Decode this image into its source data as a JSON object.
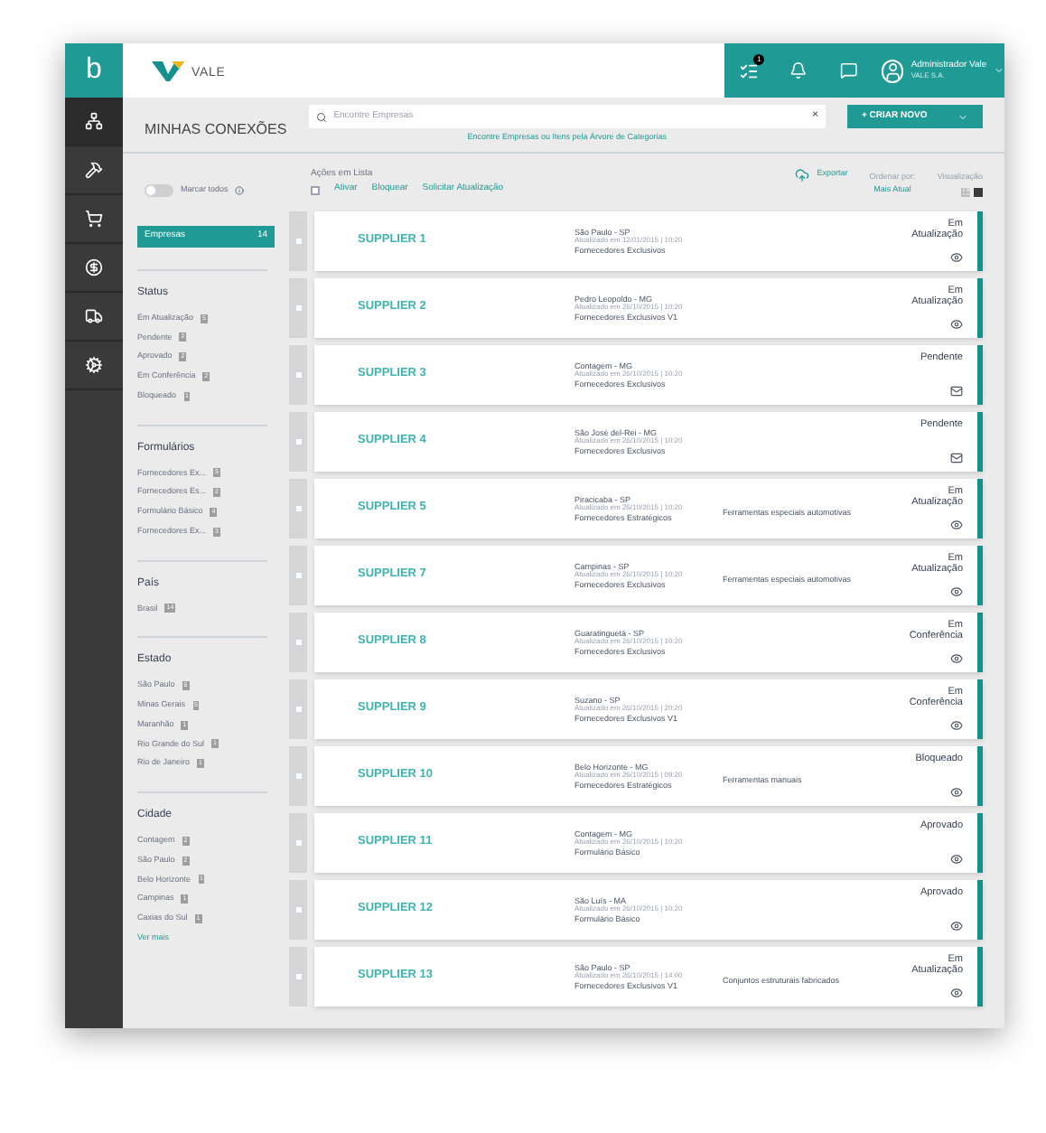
{
  "brand": {
    "logo_letter": "b",
    "name": "VALE"
  },
  "rail": [
    {
      "kind": "network",
      "selected": true
    },
    {
      "kind": "hammer",
      "selected": false
    },
    {
      "kind": "cart",
      "selected": false
    },
    {
      "kind": "coin",
      "selected": false
    },
    {
      "kind": "truck",
      "selected": false
    },
    {
      "kind": "gears",
      "selected": false
    }
  ],
  "header": {
    "notification_count": "1",
    "user_name": "Administrador Vale",
    "user_company": "VALE S.A."
  },
  "page_title": "MINHAS CONEXÕES",
  "search": {
    "placeholder": "Encontre Empresas",
    "clear": "×",
    "link": "Encontre Empresas ou Itens pela Árvore de Categorias"
  },
  "create_button": "+ CRIAR NOVO",
  "toggle": {
    "label": "Marcar todos",
    "on": false
  },
  "list_actions": {
    "title": "Ações em Lista",
    "checked": false,
    "actions": [
      "Ativar",
      "Bloquear",
      "Solicitar Atualização"
    ]
  },
  "export": "Exportar",
  "sort": {
    "label": "Ordenar por:",
    "value": "Mais Atual"
  },
  "view": {
    "label": "Visualização",
    "options": [
      {
        "kind": "grid",
        "selected": false
      },
      {
        "kind": "list",
        "selected": true
      }
    ]
  },
  "companies_tab": {
    "label": "Empresas",
    "count": "14"
  },
  "filters": [
    {
      "title": "Status",
      "items": [
        {
          "label": "Em Atualização",
          "count": "5"
        },
        {
          "label": "Pendente",
          "count": "2"
        },
        {
          "label": "Aprovado",
          "count": "2"
        },
        {
          "label": "Em Conferência",
          "count": "2"
        },
        {
          "label": "Bloqueado",
          "count": "1"
        }
      ]
    },
    {
      "title": "Formulários",
      "items": [
        {
          "label": "Fornecedores Ex...",
          "count": "5"
        },
        {
          "label": "Fornecedores Es...",
          "count": "2"
        },
        {
          "label": "Formulário Básico",
          "count": "4"
        },
        {
          "label": "Fornecedores Ex...",
          "count": "3"
        }
      ]
    },
    {
      "title": "País",
      "items": [
        {
          "label": "Brasil",
          "count": "14"
        }
      ]
    },
    {
      "title": "Estado",
      "items": [
        {
          "label": "São Paulo",
          "count": "6"
        },
        {
          "label": "Minas Gerais",
          "count": "5"
        },
        {
          "label": "Maranhão",
          "count": "1"
        },
        {
          "label": "Rio Grande do Sul",
          "count": "1"
        },
        {
          "label": "Rio de Janeiro",
          "count": "1"
        }
      ]
    },
    {
      "title": "Cidade",
      "items": [
        {
          "label": "Contagem",
          "count": "2"
        },
        {
          "label": "São Paulo",
          "count": "2"
        },
        {
          "label": "Belo Horizonte",
          "count": "1"
        },
        {
          "label": "Campinas",
          "count": "1"
        },
        {
          "label": "Caxias do Sul",
          "count": "1"
        }
      ],
      "more": "Ver mais"
    }
  ],
  "suppliers": [
    {
      "kind": "view",
      "checked": false,
      "name": "SUPPLIER 1",
      "location": "São Paulo - SP",
      "updated": "Atualizado em 12/01/2015 | 10:20",
      "category": "Fornecedores Exclusivos",
      "status": "Em Atualização"
    },
    {
      "kind": "view",
      "checked": false,
      "name": "SUPPLIER 2",
      "location": "Pedro Leopoldo - MG",
      "updated": "Atualizado em 26/10/2015 | 10:20",
      "category": "Fornecedores Exclusivos V1",
      "status": "Em Atualização"
    },
    {
      "kind": "mail",
      "checked": false,
      "name": "SUPPLIER 3",
      "location": "Contagem - MG",
      "updated": "Atualizado em 26/10/2015 | 10:20",
      "category": "Fornecedores Exclusivos",
      "status": "Pendente"
    },
    {
      "kind": "mail",
      "checked": false,
      "name": "SUPPLIER 4",
      "location": "São José del-Rei - MG",
      "updated": "Atualizado em 26/10/2015 | 10:20",
      "category": "Fornecedores Exclusivos",
      "status": "Pendente"
    },
    {
      "kind": "view",
      "checked": false,
      "name": "SUPPLIER 5",
      "location": "Piracicaba - SP",
      "updated": "Atualizado em 26/10/2015 | 10:20",
      "category": "Fornecedores Estratégicos",
      "tag": "Ferramentas especiais automotivas",
      "status": "Em Atualização"
    },
    {
      "kind": "view",
      "checked": false,
      "name": "SUPPLIER 7",
      "location": "Campinas - SP",
      "updated": "Atualizado em 26/10/2015 | 10:20",
      "category": "Fornecedores Exclusivos",
      "tag": "Ferramentas especiais automotivas",
      "status": "Em Atualização"
    },
    {
      "kind": "view",
      "checked": false,
      "name": "SUPPLIER 8",
      "location": "Guaratinguetá - SP",
      "updated": "Atualizado em 26/10/2015 | 10:20",
      "category": "Fornecedores Exclusivos",
      "status": "Em Conferência"
    },
    {
      "kind": "view",
      "checked": false,
      "name": "SUPPLIER 9",
      "location": "Suzano - SP",
      "updated": "Atualizado em 26/10/2015 | 20:20",
      "category": "Fornecedores Exclusivos V1",
      "status": "Em Conferência"
    },
    {
      "kind": "view",
      "checked": false,
      "name": "SUPPLIER 10",
      "location": "Belo Horizonte - MG",
      "updated": "Atualizado em 26/10/2015 | 09:20",
      "category": "Fornecedores Estratégicos",
      "tag": "Ferramentas manuais",
      "status": "Bloqueado"
    },
    {
      "kind": "view",
      "checked": false,
      "name": "SUPPLIER 11",
      "location": "Contagem - MG",
      "updated": "Atualizado em 26/10/2015 | 10:20",
      "category": "Formulário Básico",
      "status": "Aprovado"
    },
    {
      "kind": "view",
      "checked": false,
      "name": "SUPPLIER 12",
      "location": "São Luís - MA",
      "updated": "Atualizado em 26/10/2015 | 10:20",
      "category": "Formulário Básico",
      "status": "Aprovado"
    },
    {
      "kind": "view",
      "checked": false,
      "name": "SUPPLIER 13",
      "location": "São Paulo - SP",
      "updated": "Atualizado em 26/10/2015 | 14:00",
      "category": "Fornecedores Exclusivos V1",
      "tag": "Conjuntos estruturais fabricados",
      "status": "Em Atualização"
    }
  ]
}
